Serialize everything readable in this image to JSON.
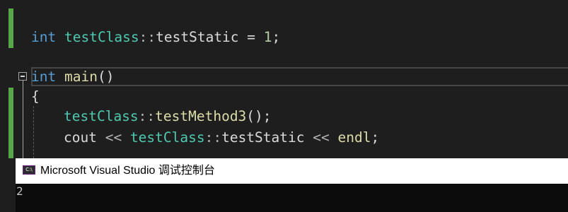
{
  "editor": {
    "line_static_init": {
      "keyword": "int",
      "type": "testClass",
      "scope": "::",
      "member": "testStatic",
      "assign": " = ",
      "value": "1",
      "end": ";"
    },
    "line_main": {
      "keyword": "int",
      "name": "main",
      "parens": "()"
    },
    "line_brace": "{",
    "line_call": {
      "type": "testClass",
      "scope": "::",
      "method": "testMethod3",
      "parens": "()",
      "end": ";"
    },
    "line_cout": {
      "cout": "cout",
      "op1": " << ",
      "type": "testClass",
      "scope": "::",
      "member": "testStatic",
      "op2": " << ",
      "endl": "endl",
      "end": ";"
    },
    "icons": {
      "fold": "collapse-box-icon"
    },
    "colors": {
      "keyword": "#569cd6",
      "type": "#4ec9b0",
      "function": "#dcdcaa",
      "number": "#b5cea8",
      "change_bar": "#57a64a"
    }
  },
  "console": {
    "title": "Microsoft Visual Studio 调试控制台",
    "icon_text": "C:\\",
    "icon_name": "console-app-icon",
    "output": "2"
  }
}
